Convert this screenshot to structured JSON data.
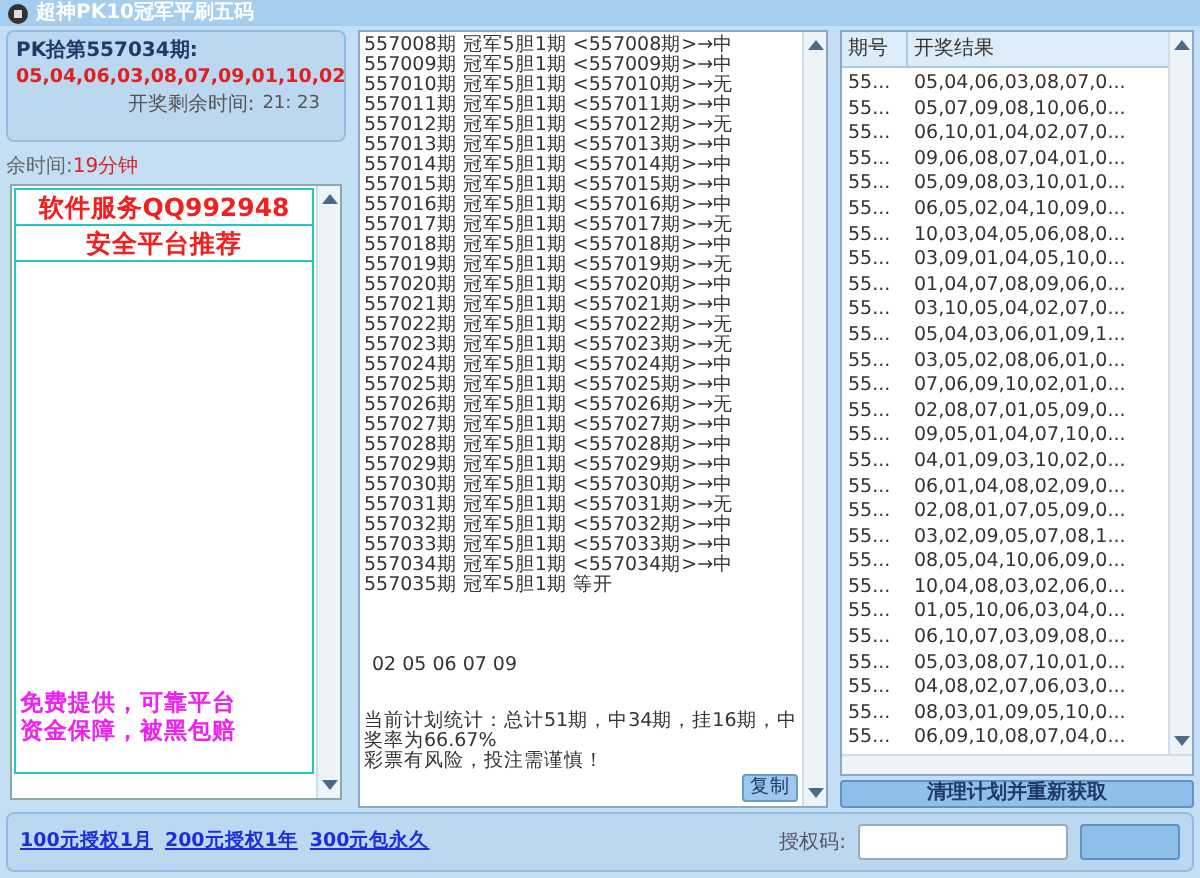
{
  "window": {
    "title": "超神PK10冠军平刷五码"
  },
  "countdown": {
    "issue_label": "PK拾第557034期:",
    "numbers": "05,04,06,03,08,07,09,01,10,02",
    "remaining_label": "开奖剩余时间:",
    "remaining_value": "21: 23"
  },
  "remaining": {
    "label": "余时间:",
    "value": "19分钟"
  },
  "ad": {
    "headlines": [
      "软件服务QQ992948",
      "安全平台推荐"
    ],
    "promo": [
      "免费提供，可靠平台",
      "资金保障，被黑包赔"
    ]
  },
  "log": {
    "lines": [
      "557008期 冠军5胆1期 <557008期>→中",
      "557009期 冠军5胆1期 <557009期>→中",
      "557010期 冠军5胆1期 <557010期>→无",
      "557011期 冠军5胆1期 <557011期>→中",
      "557012期 冠军5胆1期 <557012期>→无",
      "557013期 冠军5胆1期 <557013期>→中",
      "557014期 冠军5胆1期 <557014期>→中",
      "557015期 冠军5胆1期 <557015期>→中",
      "557016期 冠军5胆1期 <557016期>→中",
      "557017期 冠军5胆1期 <557017期>→无",
      "557018期 冠军5胆1期 <557018期>→中",
      "557019期 冠军5胆1期 <557019期>→无",
      "557020期 冠军5胆1期 <557020期>→中",
      "557021期 冠军5胆1期 <557021期>→中",
      "557022期 冠军5胆1期 <557022期>→无",
      "557023期 冠军5胆1期 <557023期>→无",
      "557024期 冠军5胆1期 <557024期>→中",
      "557025期 冠军5胆1期 <557025期>→中",
      "557026期 冠军5胆1期 <557026期>→无",
      "557027期 冠军5胆1期 <557027期>→中",
      "557028期 冠军5胆1期 <557028期>→中",
      "557029期 冠军5胆1期 <557029期>→中",
      "557030期 冠军5胆1期 <557030期>→中",
      "557031期 冠军5胆1期 <557031期>→无",
      "557032期 冠军5胆1期 <557032期>→中",
      "557033期 冠军5胆1期 <557033期>→中",
      "557034期 冠军5胆1期 <557034期>→中",
      "557035期 冠军5胆1期 等开"
    ],
    "picks": "02 05 06 07 09",
    "stats": "当前计划统计：总计51期，中34期，挂16期，中奖率为66.67%",
    "warning": "彩票有风险，投注需谨慎！",
    "copy_button": "复制"
  },
  "results": {
    "columns": [
      "期号",
      "开奖结果"
    ],
    "rows": [
      [
        "55...",
        "05,04,06,03,08,07,0..."
      ],
      [
        "55...",
        "05,07,09,08,10,06,0..."
      ],
      [
        "55...",
        "06,10,01,04,02,07,0..."
      ],
      [
        "55...",
        "09,06,08,07,04,01,0..."
      ],
      [
        "55...",
        "05,09,08,03,10,01,0..."
      ],
      [
        "55...",
        "06,05,02,04,10,09,0..."
      ],
      [
        "55...",
        "10,03,04,05,06,08,0..."
      ],
      [
        "55...",
        "03,09,01,04,05,10,0..."
      ],
      [
        "55...",
        "01,04,07,08,09,06,0..."
      ],
      [
        "55...",
        "03,10,05,04,02,07,0..."
      ],
      [
        "55...",
        "05,04,03,06,01,09,1..."
      ],
      [
        "55...",
        "03,05,02,08,06,01,0..."
      ],
      [
        "55...",
        "07,06,09,10,02,01,0..."
      ],
      [
        "55...",
        "02,08,07,01,05,09,0..."
      ],
      [
        "55...",
        "09,05,01,04,07,10,0..."
      ],
      [
        "55...",
        "04,01,09,03,10,02,0..."
      ],
      [
        "55...",
        "06,01,04,08,02,09,0..."
      ],
      [
        "55...",
        "02,08,01,07,05,09,0..."
      ],
      [
        "55...",
        "03,02,09,05,07,08,1..."
      ],
      [
        "55...",
        "08,05,04,10,06,09,0..."
      ],
      [
        "55...",
        "10,04,08,03,02,06,0..."
      ],
      [
        "55...",
        "01,05,10,06,03,04,0..."
      ],
      [
        "55...",
        "06,10,07,03,09,08,0..."
      ],
      [
        "55...",
        "05,03,08,07,10,01,0..."
      ],
      [
        "55...",
        "04,08,02,07,06,03,0..."
      ],
      [
        "55...",
        "08,03,01,09,05,10,0..."
      ],
      [
        "55...",
        "06,09,10,08,07,04,0..."
      ]
    ],
    "refresh_button": "清理计划并重新获取"
  },
  "footer": {
    "links": [
      "100元授权1月",
      "200元授权1年",
      "300元包永久"
    ],
    "auth_label": "授权码:"
  }
}
